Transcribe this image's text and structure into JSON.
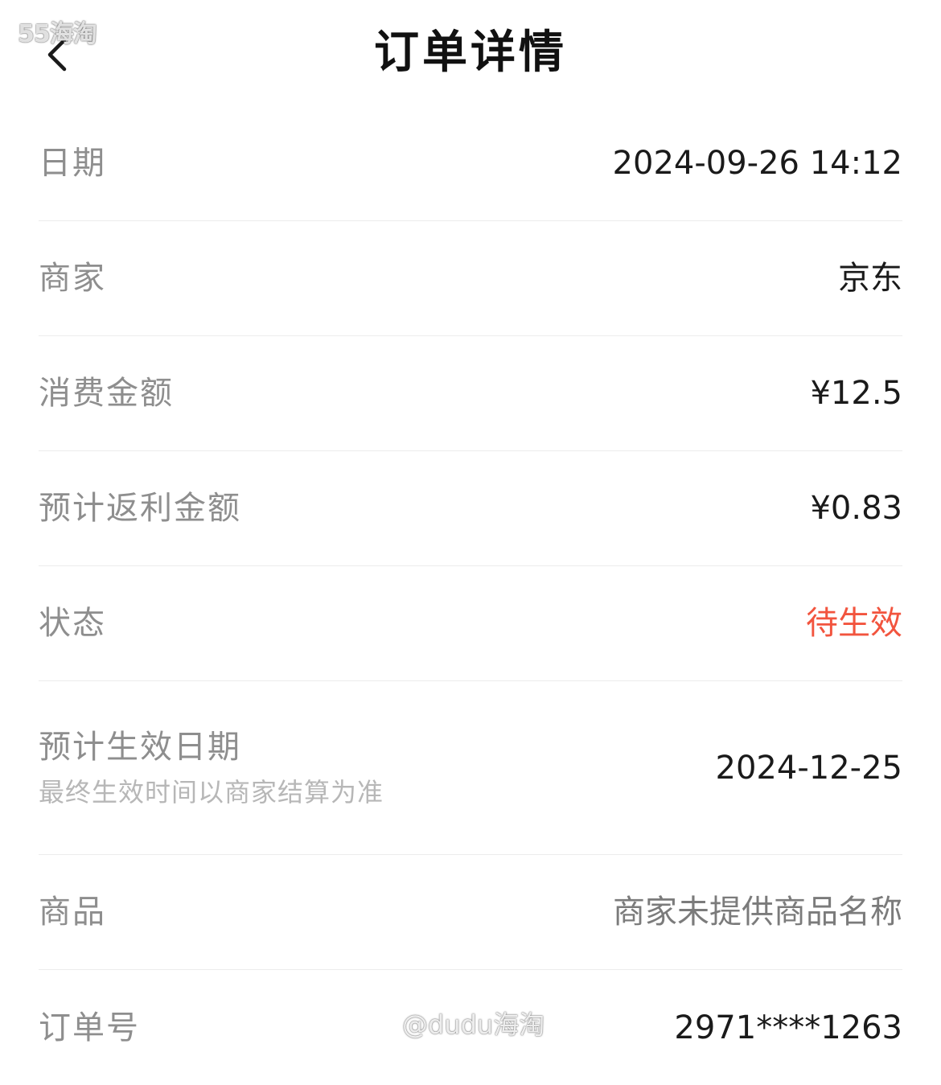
{
  "watermark_top": "55海淘",
  "header": {
    "title": "订单详情",
    "back_icon": "chevron-left-icon"
  },
  "rows": {
    "date": {
      "label": "日期",
      "value": "2024-09-26 14:12"
    },
    "merchant": {
      "label": "商家",
      "value": "京东"
    },
    "amount": {
      "label": "消费金额",
      "value": "¥12.5"
    },
    "rebate": {
      "label": "预计返利金额",
      "value": "¥0.83"
    },
    "status": {
      "label": "状态",
      "value": "待生效",
      "color": "#f2543e"
    },
    "effective_date": {
      "label": "预计生效日期",
      "sublabel": "最终生效时间以商家结算为准",
      "value": "2024-12-25"
    },
    "product": {
      "label": "商品",
      "value": "商家未提供商品名称"
    },
    "order_no": {
      "label": "订单号",
      "value": "2971****1263"
    }
  },
  "watermark_bottom": "@dudu海淘"
}
